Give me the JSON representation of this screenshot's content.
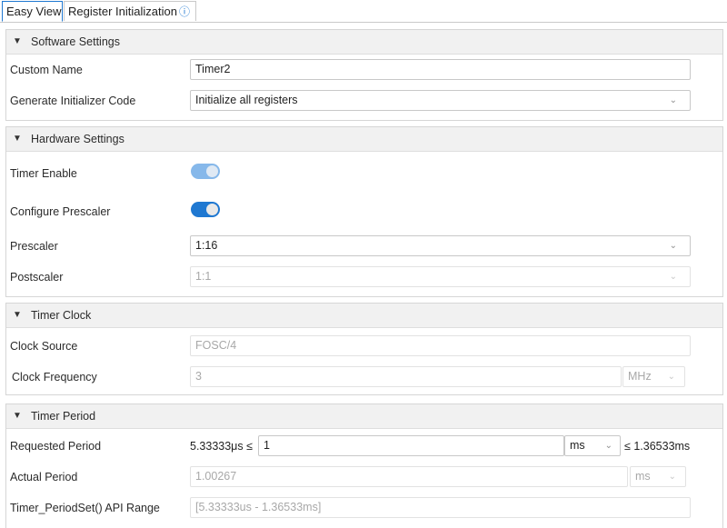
{
  "tabs": [
    {
      "label": "Easy View",
      "active": true
    },
    {
      "label": "Register Initialization",
      "active": false,
      "icon": "info-icon"
    }
  ],
  "software_settings": {
    "title": "Software Settings",
    "custom_name": {
      "label": "Custom Name",
      "value": "Timer2"
    },
    "generate_initializer": {
      "label": "Generate Initializer Code",
      "value": "Initialize all registers"
    }
  },
  "hardware_settings": {
    "title": "Hardware Settings",
    "timer_enable": {
      "label": "Timer Enable",
      "state": "on",
      "enabled": false
    },
    "configure_prescaler": {
      "label": "Configure Prescaler",
      "state": "on",
      "enabled": true
    },
    "prescaler": {
      "label": "Prescaler",
      "value": "1:16"
    },
    "postscaler": {
      "label": "Postscaler",
      "value": "1:1",
      "enabled": false
    }
  },
  "timer_clock": {
    "title": "Timer Clock",
    "clock_source": {
      "label": "Clock Source",
      "value": "FOSC/4"
    },
    "clock_frequency": {
      "label": "Clock Frequency",
      "value": "3",
      "unit": "MHz"
    }
  },
  "timer_period": {
    "title": "Timer Period",
    "requested_period": {
      "label": "Requested Period",
      "min": "5.33333μs ≤",
      "value": "1",
      "unit": "ms",
      "max": "≤ 1.36533ms"
    },
    "actual_period": {
      "label": "Actual Period",
      "value": "1.00267",
      "unit": "ms"
    },
    "api_range": {
      "label": "Timer_PeriodSet() API Range",
      "value": "[5.33333us - 1.36533ms]"
    }
  },
  "colors": {
    "accent": "#1f78d1",
    "accent_disabled": "#86b8ea"
  }
}
